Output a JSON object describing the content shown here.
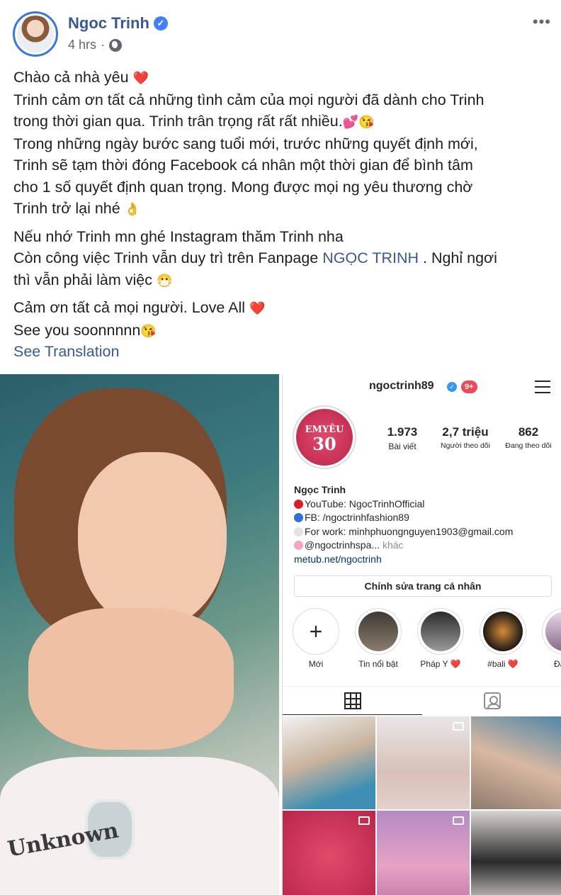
{
  "post": {
    "author": "Ngoc Trinh",
    "time": "4 hrs",
    "more": "•••",
    "text": {
      "p1_l1": "Chào cả nhà yêu",
      "p1_l2": "Trinh cảm ơn tất cả những tình cảm của mọi người đã dành cho Trinh",
      "p1_l3": "trong thời gian qua. Trinh trân trọng rất rất nhiều.",
      "p1_l4": "Trong những ngày bước sang tuổi mới, trước những quyết định mới,",
      "p1_l5": "Trinh sẽ tạm thời đóng Facebook cá nhân một thời gian để bình tâm",
      "p1_l6": "cho 1 số quyết định quan trọng. Mong được mọi ng yêu thương chờ",
      "p1_l7": "Trinh trở lại nhé",
      "p2_l1": "Nếu nhớ Trinh mn ghé Instagram thăm Trinh nha",
      "p2_l2a": "Còn công việc Trinh vẫn duy trì trên Fanpage",
      "p2_link": "NGỌC TRINH",
      "p2_l2b": ". Nghỉ ngơi",
      "p2_l3": "thì vẫn phải làm việc",
      "p3_l1": "Cảm ơn tất cả mọi người. Love All",
      "p3_l2": "See you soonnnnn"
    },
    "see_translation": "See Translation"
  },
  "photo": {
    "shirt_text": "Unknown"
  },
  "instagram": {
    "username": "ngoctrinh89",
    "notifications": "9+",
    "stats": [
      {
        "num": "1.973",
        "label": "Bài viết"
      },
      {
        "num": "2,7 triệu",
        "label": "Người theo dõi"
      },
      {
        "num": "862",
        "label": "Đang theo dõi"
      }
    ],
    "profile_pic_text_1": "EMYÊU",
    "profile_pic_text_2": "30",
    "bio": {
      "name": "Ngọc Trinh",
      "youtube": "YouTube: NgocTrinhOfficial",
      "fb": "FB: /ngoctrinhfashion89",
      "work": "For work: minhphuongnguyen1903@gmail.com",
      "spa": "@ngoctrinhspa...",
      "spa_more": "khác",
      "link": "metub.net/ngoctrinh"
    },
    "edit_profile": "Chỉnh sửa trang cá nhân",
    "highlights": [
      {
        "label": "Mới"
      },
      {
        "label": "Tin nổi bật"
      },
      {
        "label": "Pháp Y ❤️"
      },
      {
        "label": "#bali ❤️"
      },
      {
        "label": "Đập h"
      }
    ]
  }
}
